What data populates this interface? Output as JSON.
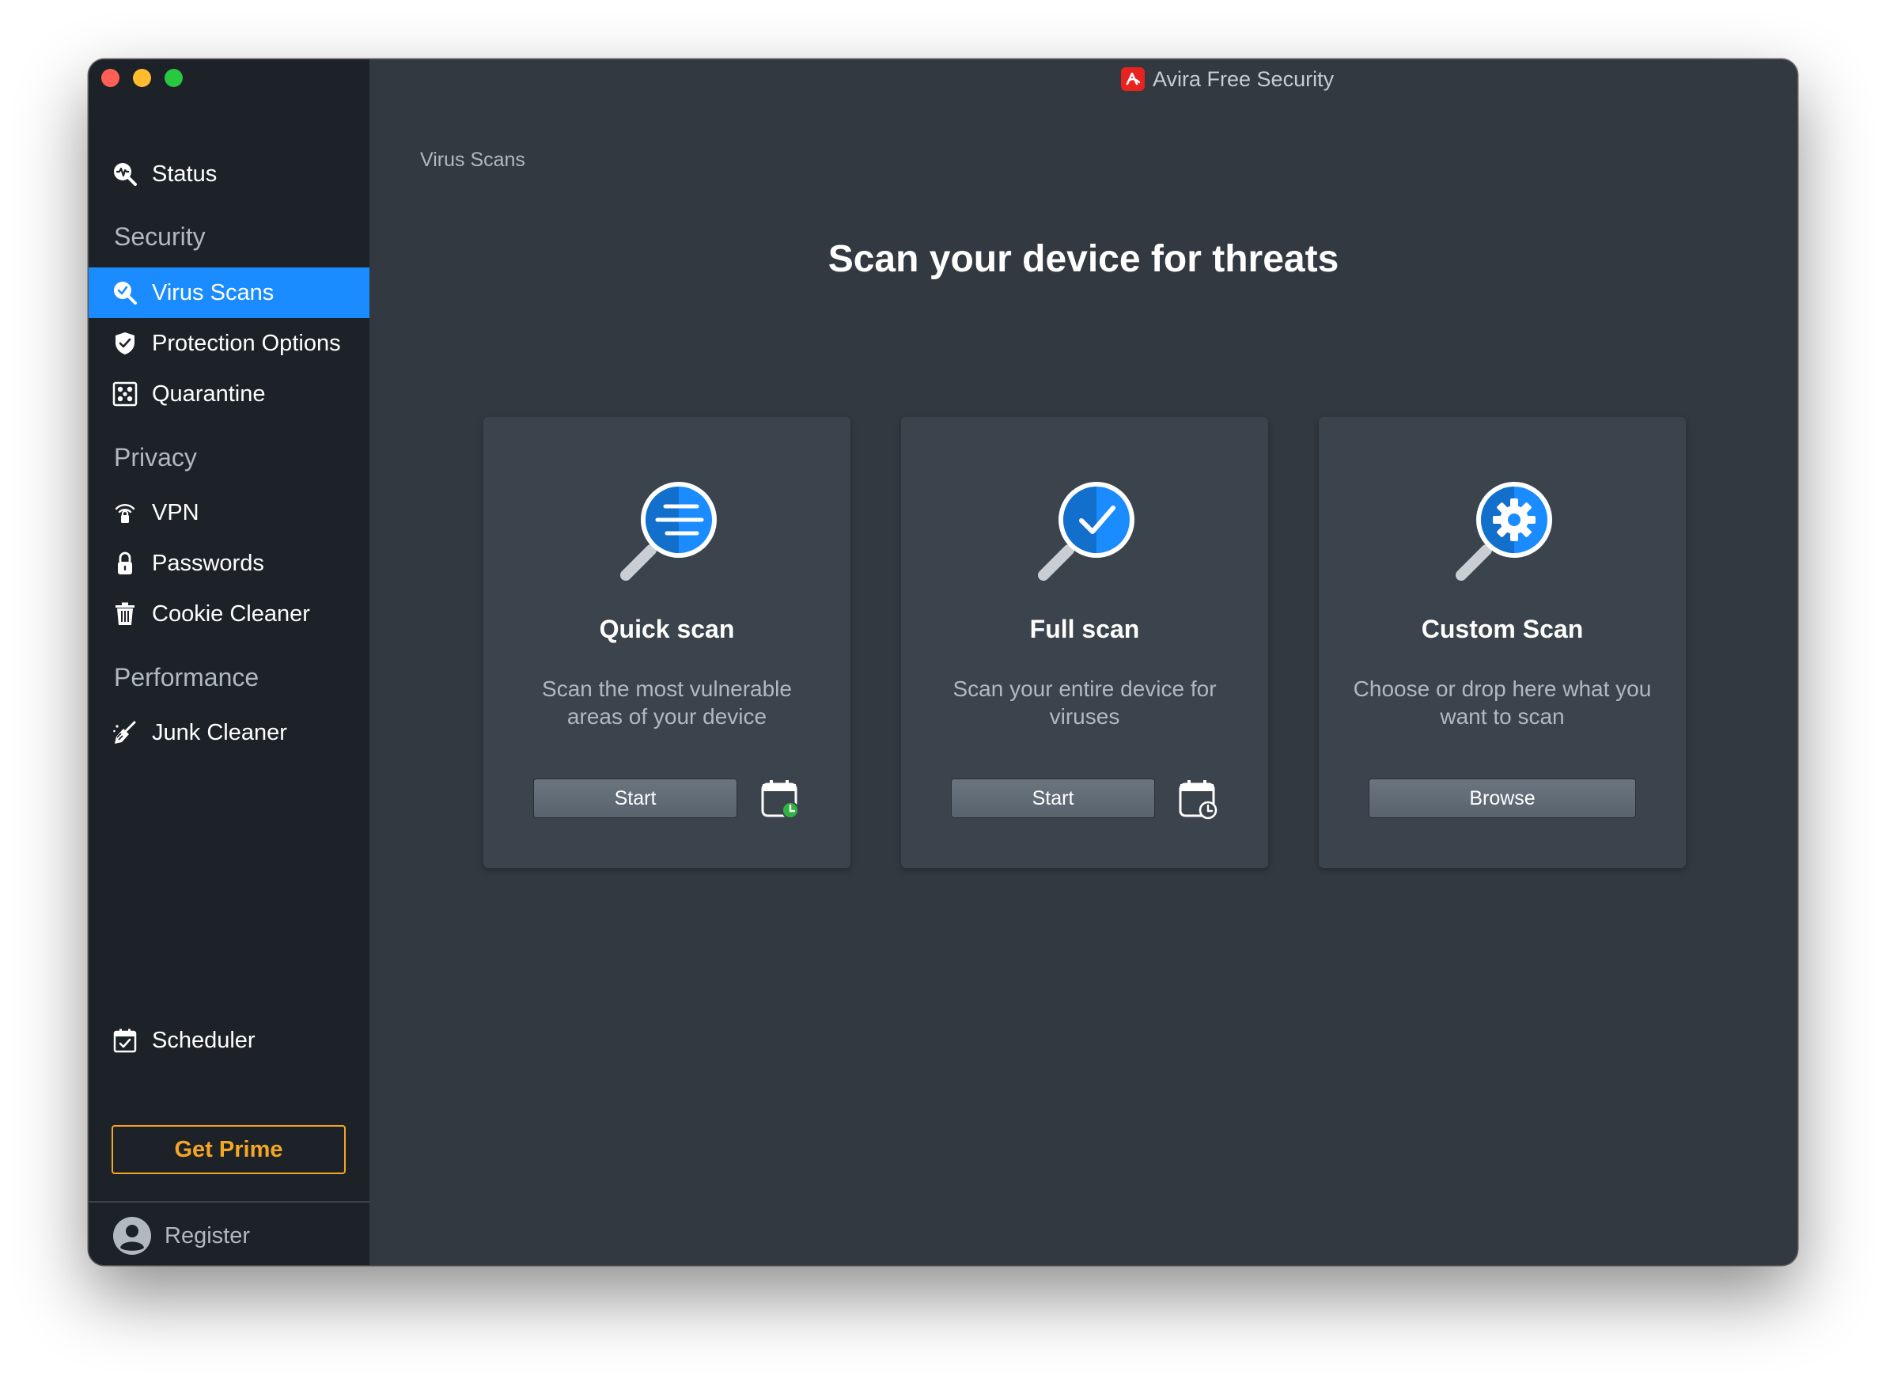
{
  "window": {
    "title": "Avira Free Security"
  },
  "sidebar": {
    "status_label": "Status",
    "sections": {
      "security": "Security",
      "privacy": "Privacy",
      "performance": "Performance"
    },
    "items": {
      "virus_scans": "Virus Scans",
      "protection_options": "Protection Options",
      "quarantine": "Quarantine",
      "vpn": "VPN",
      "passwords": "Passwords",
      "cookie_cleaner": "Cookie Cleaner",
      "junk_cleaner": "Junk Cleaner",
      "scheduler": "Scheduler"
    },
    "active_item": "Virus Scans",
    "get_prime_label": "Get Prime",
    "register_label": "Register"
  },
  "main": {
    "breadcrumb": "Virus Scans",
    "title": "Scan your device for threats",
    "cards": {
      "quick": {
        "title": "Quick scan",
        "description": "Scan the most vulnerable areas of your device",
        "button": "Start"
      },
      "full": {
        "title": "Full scan",
        "description": "Scan your entire device for viruses",
        "button": "Start"
      },
      "custom": {
        "title": "Custom Scan",
        "description": "Choose or drop here what you want to scan",
        "button": "Browse"
      }
    }
  },
  "colors": {
    "accent": "#1a8cff",
    "sidebar_bg": "#1c2228",
    "content_bg": "#323941",
    "card_bg": "#3b434c",
    "prime": "#f5a623",
    "brand_red": "#e8221f",
    "schedule_green": "#2fb343"
  },
  "icons": {
    "status": "status-pulse-icon",
    "virus_scans": "magnifier-check-icon",
    "protection_options": "shield-check-icon",
    "quarantine": "quarantine-box-icon",
    "vpn": "wifi-lock-icon",
    "passwords": "lock-icon",
    "cookie_cleaner": "trash-icon",
    "junk_cleaner": "broom-icon",
    "scheduler": "calendar-check-icon",
    "register": "user-avatar-icon",
    "feedback": "feedback-pen-icon"
  }
}
